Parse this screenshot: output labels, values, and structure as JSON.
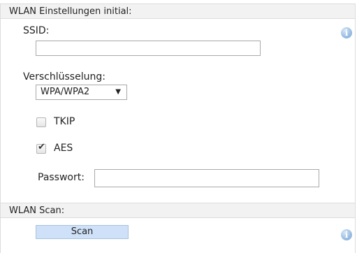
{
  "wlan_initial": {
    "header": "WLAN Einstellungen initial:",
    "ssid_label": "SSID:",
    "ssid_value": "",
    "encryption_label": "Verschlüsselung:",
    "encryption_selected": "WPA/WPA2",
    "tkip_label": "TKIP",
    "tkip_checked": false,
    "aes_label": "AES",
    "aes_checked": true,
    "password_label": "Passwort:",
    "password_value": ""
  },
  "wlan_scan": {
    "header": "WLAN Scan:",
    "scan_button_label": "Scan"
  },
  "icons": {
    "info": "info-icon",
    "info_glyph": "i",
    "dropdown_arrow": "▼",
    "check_glyph": "✔"
  },
  "colors": {
    "header_bg": "#f2f2f2",
    "scan_button_bg": "#cfe1f8",
    "info_icon": "#9dbfe3"
  }
}
